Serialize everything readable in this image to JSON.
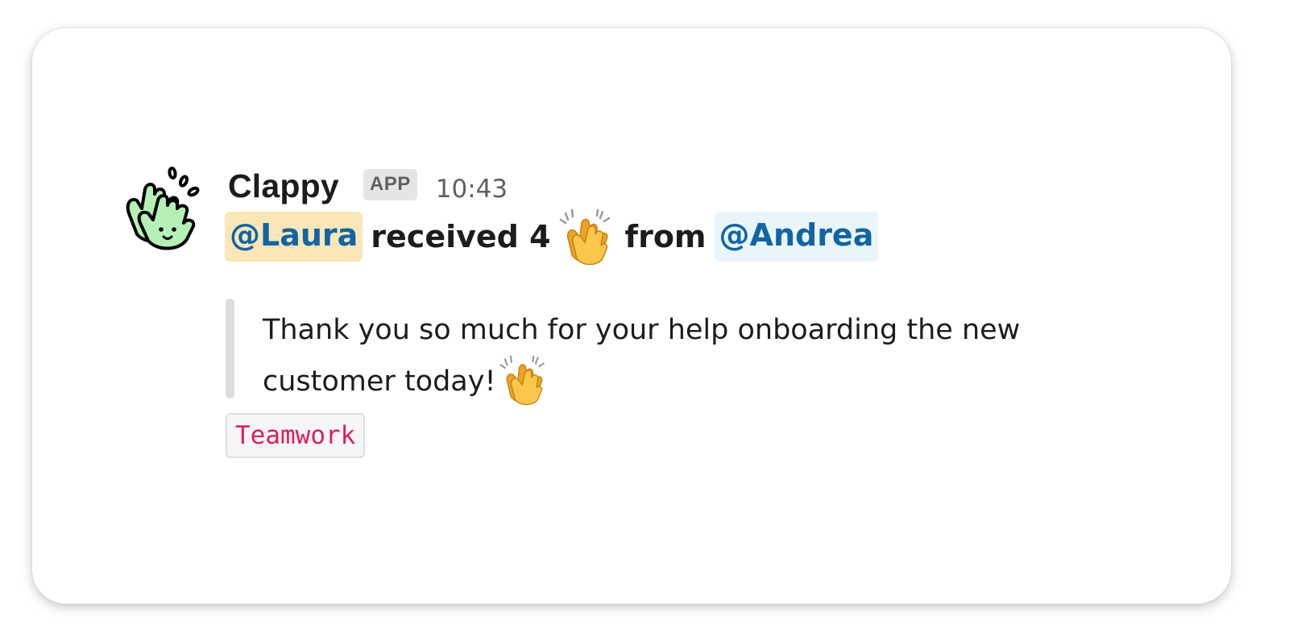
{
  "message": {
    "bot_name": "Clappy",
    "badge": "APP",
    "timestamp": "10:43",
    "headline": {
      "recipient": "@Laura",
      "verb_count": "received 4",
      "emoji": "clap-emoji",
      "from_label": "from",
      "sender": "@Andrea"
    },
    "quote": {
      "text": "Thank you so much for your help onboarding the new customer today!",
      "emoji": "clap-emoji"
    },
    "tag": "Teamwork"
  },
  "colors": {
    "mention_text": "#1264a3",
    "self_mention_bg": "#fbe6b7",
    "other_mention_bg": "#e8f5fa",
    "tag_text": "#e01e5a",
    "avatar_green": "#b6f0b6"
  }
}
